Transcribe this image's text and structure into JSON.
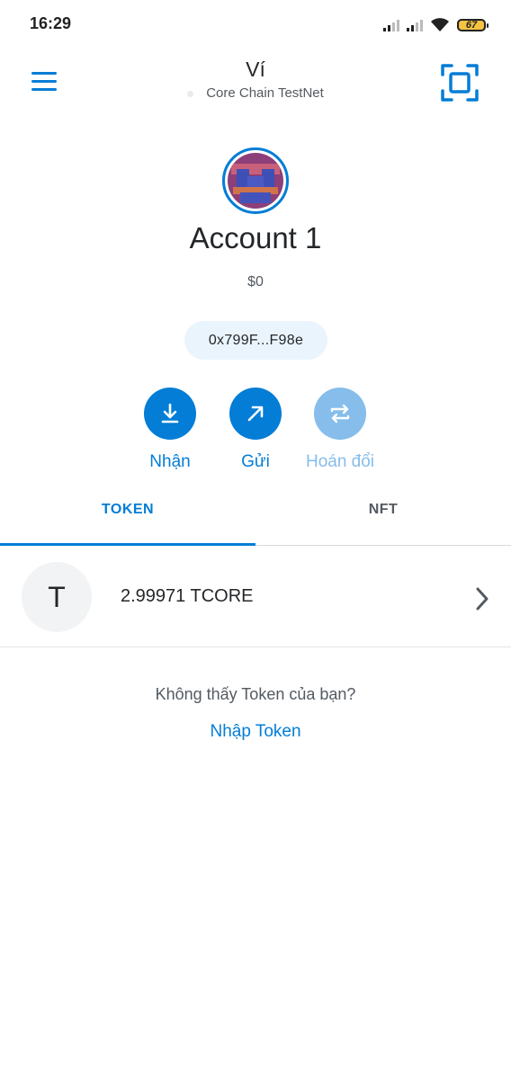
{
  "status_bar": {
    "time": "16:29",
    "battery": "67"
  },
  "header": {
    "title": "Ví",
    "network": "Core Chain TestNet"
  },
  "account": {
    "name": "Account 1",
    "balance": "$0",
    "address": "0x799F...F98e"
  },
  "actions": [
    {
      "label": "Nhận",
      "icon": "receive-icon",
      "enabled": true
    },
    {
      "label": "Gửi",
      "icon": "send-icon",
      "enabled": true
    },
    {
      "label": "Hoán đổi",
      "icon": "swap-icon",
      "enabled": false
    }
  ],
  "tabs": [
    {
      "label": "TOKEN",
      "active": true
    },
    {
      "label": "NFT",
      "active": false
    }
  ],
  "tokens": [
    {
      "icon_letter": "T",
      "amount": "2.99971 TCORE"
    }
  ],
  "empty_hint": {
    "text": "Không thấy Token của bạn?",
    "link": "Nhập Token"
  },
  "colors": {
    "accent": "#037dd6",
    "accent_disabled": "#86bdeb",
    "avatar_ring": "#037dd6"
  }
}
